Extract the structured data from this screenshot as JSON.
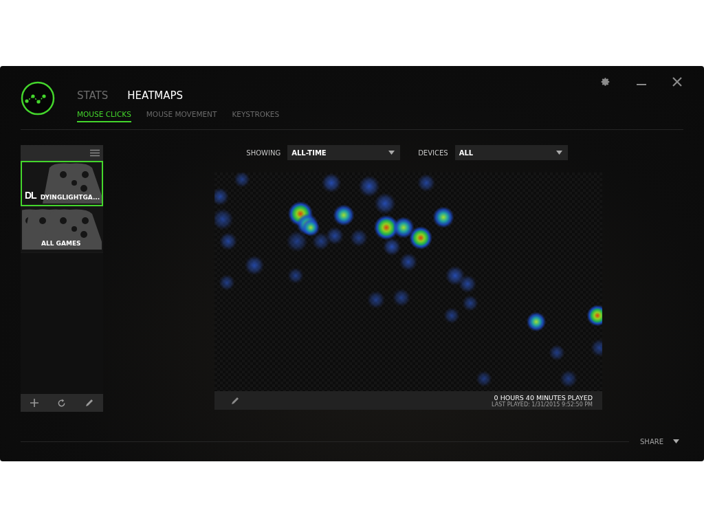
{
  "nav_tabs": [
    {
      "label": "STATS",
      "selected": false
    },
    {
      "label": "HEATMAPS",
      "selected": true
    }
  ],
  "sub_tabs": [
    {
      "label": "MOUSE CLICKS",
      "selected": true
    },
    {
      "label": "MOUSE MOVEMENT",
      "selected": false
    },
    {
      "label": "KEYSTROKES",
      "selected": false
    }
  ],
  "games": [
    {
      "kind": "game",
      "logo_text": "DL",
      "name": "DYINGLIGHTGA...",
      "selected": true
    },
    {
      "kind": "all",
      "name": "ALL GAMES",
      "selected": false
    }
  ],
  "filters": [
    {
      "label": "SHOWING",
      "value": "ALL-TIME"
    },
    {
      "label": "DEVICES",
      "value": "ALL"
    }
  ],
  "heatmap": {
    "playtime": "0 HOURS 40 MINUTES PLAYED",
    "last_played": "LAST PLAYED: 1/31/2015 9:52:50 PM"
  },
  "share": "SHARE"
}
